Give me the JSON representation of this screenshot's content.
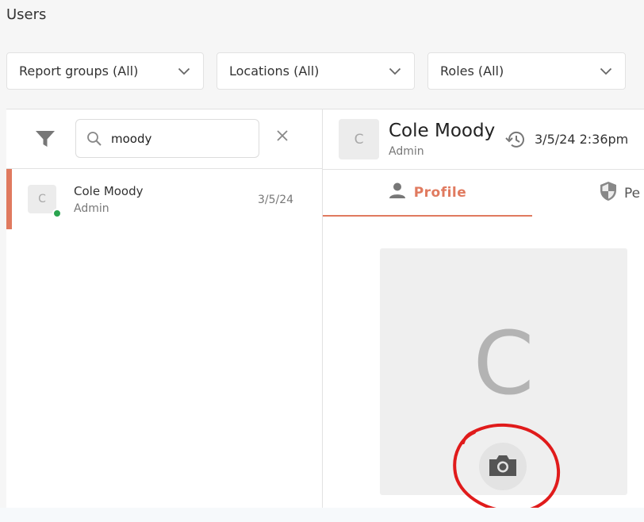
{
  "page": {
    "title": "Users"
  },
  "filters": {
    "report_groups": "Report groups (All)",
    "locations": "Locations (All)",
    "roles": "Roles (All)"
  },
  "search": {
    "value": "moody",
    "placeholder": ""
  },
  "user_list": [
    {
      "initial": "C",
      "name": "Cole Moody",
      "role": "Admin",
      "date": "3/5/24",
      "status": "online"
    }
  ],
  "detail": {
    "initial": "C",
    "name": "Cole Moody",
    "role": "Admin",
    "last_seen": "3/5/24 2:36pm",
    "tabs": {
      "profile": "Profile",
      "permissions": "Pe"
    },
    "photo_initial": "C"
  },
  "colors": {
    "accent": "#e07a5f",
    "online": "#2aa44f",
    "annotation": "#e01b1b"
  }
}
